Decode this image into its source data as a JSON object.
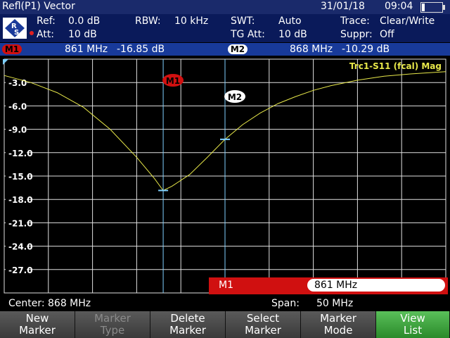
{
  "header": {
    "title": "Refl(P1) Vector",
    "date": "31/01/18",
    "time": "09:04"
  },
  "info": {
    "ref_label": "Ref:",
    "ref_value": "0.0 dB",
    "att_label": "Att:",
    "att_value": "10 dB",
    "rbw_label": "RBW:",
    "rbw_value": "10 kHz",
    "swt_label": "SWT:",
    "swt_value": "Auto",
    "tgatt_label": "TG Att:",
    "tgatt_value": "10 dB",
    "trace_label": "Trace:",
    "trace_value": "Clear/Write",
    "suppr_label": "Suppr:",
    "suppr_value": "Off"
  },
  "markers_bar": {
    "m1_label": "M1",
    "m1_freq": "861 MHz",
    "m1_level": "-16.85 dB",
    "m2_label": "M2",
    "m2_freq": "868 MHz",
    "m2_level": "-10.29 dB"
  },
  "plot": {
    "trace_label": "Trc1-S11 (fcal) Mag",
    "y_ticks": [
      "-3.0",
      "-6.0",
      "-9.0",
      "-12.0",
      "-15.0",
      "-18.0",
      "-21.0",
      "-24.0",
      "-27.0"
    ],
    "marker1_tag": "M1",
    "marker2_tag": "M2"
  },
  "chart_data": {
    "type": "line",
    "series": [
      {
        "x": [
          843,
          846,
          849,
          852,
          855,
          858,
          860,
          861,
          862,
          864,
          866,
          868,
          870,
          872,
          874,
          876,
          878,
          880,
          883,
          886,
          889,
          893
        ],
        "y": [
          -2.1,
          -3.0,
          -4.3,
          -6.2,
          -9.0,
          -12.6,
          -15.3,
          -16.85,
          -16.3,
          -14.8,
          -12.6,
          -10.29,
          -8.4,
          -6.9,
          -5.7,
          -4.8,
          -4.0,
          -3.4,
          -2.7,
          -2.2,
          -1.9,
          -1.6
        ]
      }
    ],
    "xlim": [
      843,
      893
    ],
    "ylim": [
      -30,
      0
    ],
    "markers": [
      {
        "name": "M1",
        "x": 861,
        "y": -16.85
      },
      {
        "name": "M2",
        "x": 868,
        "y": -10.29
      }
    ],
    "grid": true
  },
  "marker_field": {
    "label": "M1",
    "value": "861 MHz"
  },
  "status": {
    "center_label": "Center:",
    "center_value": "868 MHz",
    "span_label": "Span:",
    "span_value": "50 MHz"
  },
  "softkeys": [
    {
      "line1": "New",
      "line2": "Marker"
    },
    {
      "line1": "Marker",
      "line2": "Type"
    },
    {
      "line1": "Delete",
      "line2": "Marker"
    },
    {
      "line1": "Select",
      "line2": "Marker"
    },
    {
      "line1": "Marker",
      "line2": "Mode"
    },
    {
      "line1": "View",
      "line2": "List"
    }
  ],
  "colors": {
    "trace": "#e8e84a",
    "marker_line": "#7fd0ff",
    "marker_red": "#d01010",
    "active_key": "#3aa03a"
  }
}
